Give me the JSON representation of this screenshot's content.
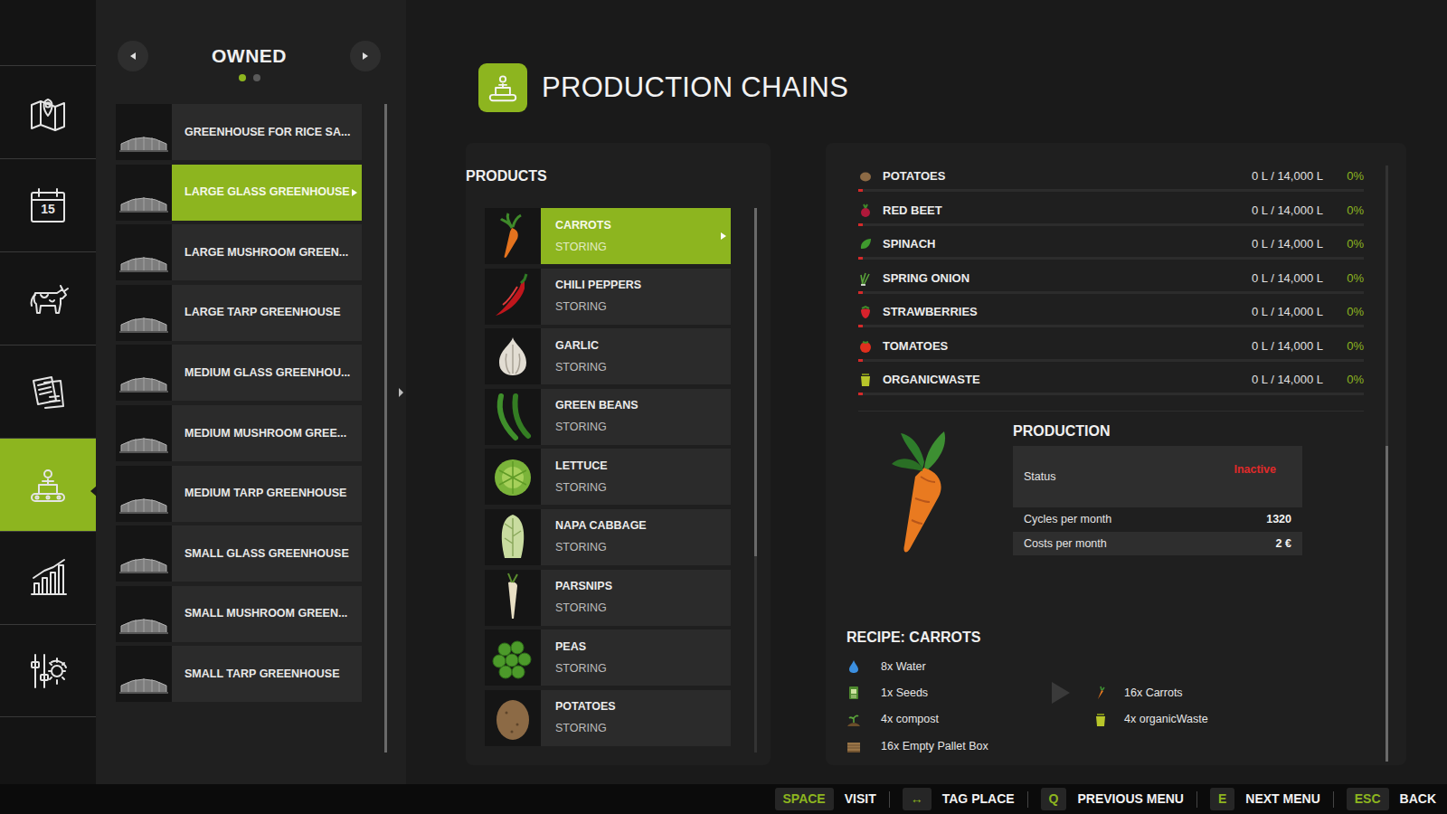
{
  "sidebar": {
    "items": [
      {
        "selected": false
      },
      {
        "selected": false,
        "badge": "15"
      },
      {
        "selected": false
      },
      {
        "selected": false
      },
      {
        "selected": true
      },
      {
        "selected": false
      },
      {
        "selected": false
      }
    ]
  },
  "owned": {
    "title": "OWNED",
    "pages": [
      {
        "selected": true
      },
      {
        "selected": false
      }
    ],
    "scrollbar": {
      "position": 0,
      "size": 1
    },
    "items": [
      {
        "label": "GREENHOUSE FOR RICE SA...",
        "selected": false
      },
      {
        "label": "LARGE GLASS GREENHOUSE",
        "selected": true
      },
      {
        "label": "LARGE MUSHROOM GREEN...",
        "selected": false
      },
      {
        "label": "LARGE TARP GREENHOUSE",
        "selected": false
      },
      {
        "label": "MEDIUM GLASS GREENHOU...",
        "selected": false
      },
      {
        "label": "MEDIUM MUSHROOM GREE...",
        "selected": false
      },
      {
        "label": "MEDIUM TARP GREENHOUSE",
        "selected": false
      },
      {
        "label": "SMALL GLASS GREENHOUSE",
        "selected": false
      },
      {
        "label": "SMALL MUSHROOM GREEN...",
        "selected": false
      },
      {
        "label": "SMALL TARP GREENHOUSE",
        "selected": false
      }
    ]
  },
  "page": {
    "title": "PRODUCTION CHAINS"
  },
  "products": {
    "title": "PRODUCTS",
    "scrollbar": {
      "position": 0,
      "size": 0.64
    },
    "items": [
      {
        "label": "CARROTS",
        "status": "STORING",
        "selected": true
      },
      {
        "label": "CHILI PEPPERS",
        "status": "STORING",
        "selected": false
      },
      {
        "label": "GARLIC",
        "status": "STORING",
        "selected": false
      },
      {
        "label": "GREEN BEANS",
        "status": "STORING",
        "selected": false
      },
      {
        "label": "LETTUCE",
        "status": "STORING",
        "selected": false
      },
      {
        "label": "NAPA CABBAGE",
        "status": "STORING",
        "selected": false
      },
      {
        "label": "PARSNIPS",
        "status": "STORING",
        "selected": false
      },
      {
        "label": "PEAS",
        "status": "STORING",
        "selected": false
      },
      {
        "label": "POTATOES",
        "status": "STORING",
        "selected": false
      }
    ]
  },
  "details": {
    "scrollbar": {
      "position": 0.47,
      "size": 0.53
    }
  },
  "storage": [
    {
      "name": "POTATOES",
      "amount": "0 L / 14,000 L",
      "percent": "0%",
      "level": 0
    },
    {
      "name": "RED BEET",
      "amount": "0 L / 14,000 L",
      "percent": "0%",
      "level": 0
    },
    {
      "name": "SPINACH",
      "amount": "0 L / 14,000 L",
      "percent": "0%",
      "level": 0
    },
    {
      "name": "SPRING ONION",
      "amount": "0 L / 14,000 L",
      "percent": "0%",
      "level": 0
    },
    {
      "name": "STRAWBERRIES",
      "amount": "0 L / 14,000 L",
      "percent": "0%",
      "level": 0
    },
    {
      "name": "TOMATOES",
      "amount": "0 L / 14,000 L",
      "percent": "0%",
      "level": 0
    },
    {
      "name": "ORGANICWASTE",
      "amount": "0 L / 14,000 L",
      "percent": "0%",
      "level": 0
    }
  ],
  "production": {
    "title": "PRODUCTION",
    "rows": [
      {
        "label": "Status",
        "value": "Inactive",
        "kind": "alert"
      },
      {
        "label": "Cycles per month",
        "value": "1320",
        "kind": "plain"
      },
      {
        "label": "Costs per month",
        "value": "2 €",
        "kind": "plain"
      }
    ]
  },
  "recipe": {
    "title": "RECIPE: CARROTS",
    "inputs": [
      "8x Water",
      "1x Seeds",
      "4x compost",
      "16x Empty Pallet Box"
    ],
    "outputs": [
      "16x Carrots",
      "4x organicWaste"
    ]
  },
  "hints": [
    {
      "key": "SPACE",
      "label": "VISIT"
    },
    {
      "key": "↔",
      "label": "TAG PLACE"
    },
    {
      "key": "Q",
      "label": "PREVIOUS MENU"
    },
    {
      "key": "E",
      "label": "NEXT MENU"
    },
    {
      "key": "ESC",
      "label": "BACK"
    }
  ]
}
